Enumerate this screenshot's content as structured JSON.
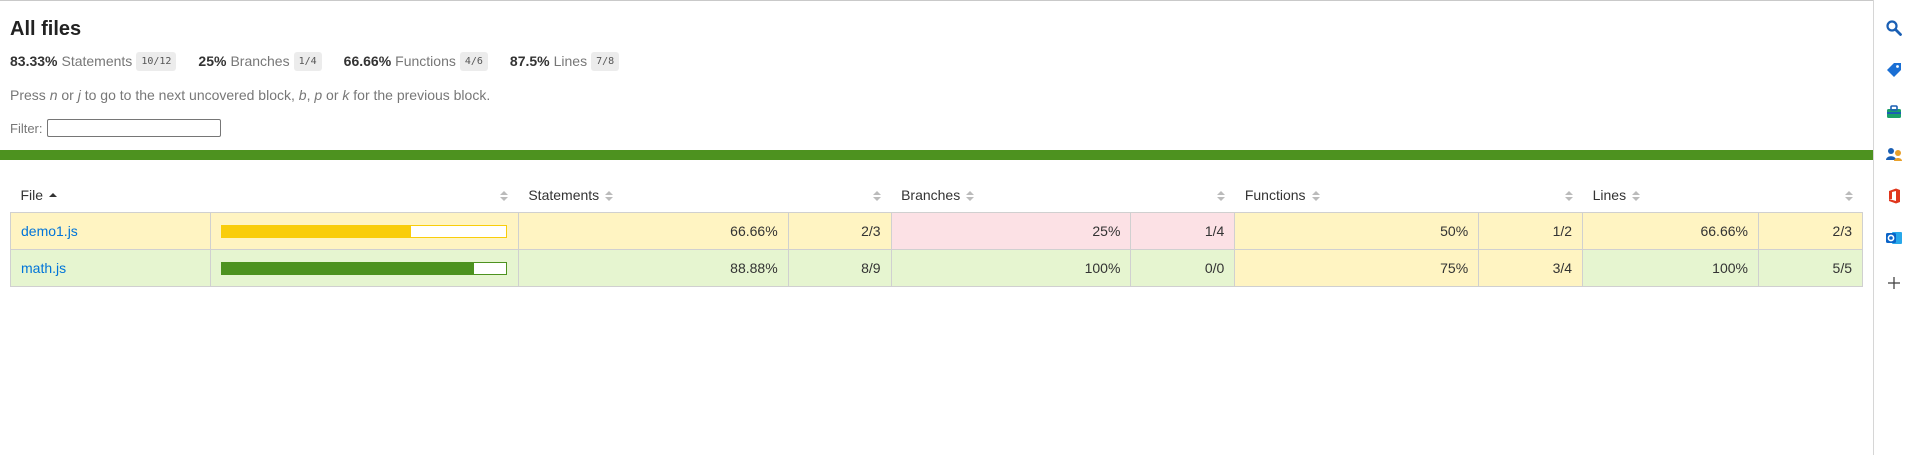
{
  "title": "All files",
  "summary": [
    {
      "pct": "83.33%",
      "label": "Statements",
      "frac": "10/12"
    },
    {
      "pct": "25%",
      "label": "Branches",
      "frac": "1/4"
    },
    {
      "pct": "66.66%",
      "label": "Functions",
      "frac": "4/6"
    },
    {
      "pct": "87.5%",
      "label": "Lines",
      "frac": "7/8"
    }
  ],
  "hint": {
    "t1": "Press ",
    "k1": "n",
    "t2": " or ",
    "k2": "j",
    "t3": " to go to the next uncovered block, ",
    "k3": "b",
    "t4": ", ",
    "k4": "p",
    "t5": " or ",
    "k5": "k",
    "t6": " for the previous block."
  },
  "filter": {
    "label": "Filter:",
    "value": ""
  },
  "colors": {
    "status_bar": "#4d921f",
    "high_bg": "#e6f5d0",
    "medium_bg": "#fff4c2",
    "low_bg": "#fce1e5",
    "high_bar": "#4d921f",
    "medium_bar": "#f9cd0b"
  },
  "table": {
    "headers": {
      "file": "File",
      "statements": "Statements",
      "branches": "Branches",
      "functions": "Functions",
      "lines": "Lines"
    },
    "rows": [
      {
        "file": "demo1.js",
        "coverage": 0.6666,
        "level": "medium",
        "statements": {
          "pct": "66.66%",
          "frac": "2/3",
          "level": "medium"
        },
        "branches": {
          "pct": "25%",
          "frac": "1/4",
          "level": "low"
        },
        "functions": {
          "pct": "50%",
          "frac": "1/2",
          "level": "medium"
        },
        "lines": {
          "pct": "66.66%",
          "frac": "2/3",
          "level": "medium"
        }
      },
      {
        "file": "math.js",
        "coverage": 0.8888,
        "level": "high",
        "statements": {
          "pct": "88.88%",
          "frac": "8/9",
          "level": "high"
        },
        "branches": {
          "pct": "100%",
          "frac": "0/0",
          "level": "high"
        },
        "functions": {
          "pct": "75%",
          "frac": "3/4",
          "level": "medium"
        },
        "lines": {
          "pct": "100%",
          "frac": "5/5",
          "level": "high"
        }
      }
    ]
  },
  "sidebar_icons": [
    "search-icon",
    "tag-icon",
    "toolbox-icon",
    "people-icon",
    "office-icon",
    "outlook-icon",
    "plus-icon"
  ]
}
